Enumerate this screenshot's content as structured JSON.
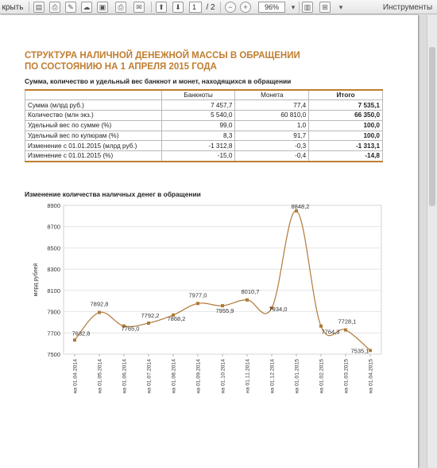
{
  "toolbar": {
    "open_label": "крыть",
    "page_current": "1",
    "page_total": "/ 2",
    "zoom": "96%",
    "tools_label": "Инструменты"
  },
  "doc": {
    "title_line1": "СТРУКТУРА НАЛИЧНОЙ ДЕНЕЖНОЙ МАССЫ В ОБРАЩЕНИИ",
    "title_line2": "ПО СОСТОЯНИЮ НА 1 АПРЕЛЯ 2015 ГОДА",
    "table_caption": "Сумма, количество и удельный вес банкнот и монет, находящихся в обращении",
    "table": {
      "headers": [
        "",
        "Банкноты",
        "Монета",
        "Итого"
      ],
      "rows": [
        [
          "Сумма (млрд руб.)",
          "7 457,7",
          "77,4",
          "7 535,1"
        ],
        [
          "Количество (млн экз.)",
          "5 540,0",
          "60 810,0",
          "66 350,0"
        ],
        [
          "Удельный вес по сумме (%)",
          "99,0",
          "1,0",
          "100,0"
        ],
        [
          "Удельный вес по купюрам (%)",
          "8,3",
          "91,7",
          "100,0"
        ],
        [
          "Изменение с 01.01.2015 (млрд руб.)",
          "-1 312,8",
          "-0,3",
          "-1 313,1"
        ],
        [
          "Изменение с 01.01.2015 (%)",
          "-15,0",
          "-0,4",
          "-14,8"
        ]
      ]
    },
    "chart_caption": "Изменение количества наличных денег в обращении"
  },
  "chart_data": {
    "type": "line",
    "title": "Изменение количества наличных денег в обращении",
    "xlabel": "",
    "ylabel": "млрд рублей",
    "ylim": [
      7500,
      8900
    ],
    "yticks": [
      7500,
      7700,
      7900,
      8100,
      8300,
      8500,
      8700,
      8900
    ],
    "ytick_labels": [
      "7500",
      "7700",
      "7900",
      "8100",
      "8300",
      "8500",
      "8700",
      "8900"
    ],
    "categories": [
      "на 01.04.2014",
      "на 01.05.2014",
      "на 01.06.2014",
      "на 01.07.2014",
      "на 01.08.2014",
      "на 01.09.2014",
      "на 01.10.2014",
      "на 01.11.2014",
      "на 01.12.2014",
      "на 01.01.2015",
      "на 01.02.2015",
      "на 01.03.2015",
      "на 01.04.2015"
    ],
    "values": [
      7632.8,
      7892.8,
      7765.0,
      7792.2,
      7868.2,
      7977.0,
      7955.9,
      8010.7,
      7934.0,
      8848.2,
      7764.3,
      7728.1,
      7535.1
    ],
    "labels": [
      "7632,8",
      "7892,8",
      "7765,0",
      "7792,2",
      "7868,2",
      "7977,0",
      "7955,9",
      "8010,7",
      "7934,0",
      "8848,2",
      "7764,3",
      "7728,1",
      "7535,1"
    ],
    "grid": true,
    "legend": "none",
    "line_color": "#b07a3a"
  }
}
